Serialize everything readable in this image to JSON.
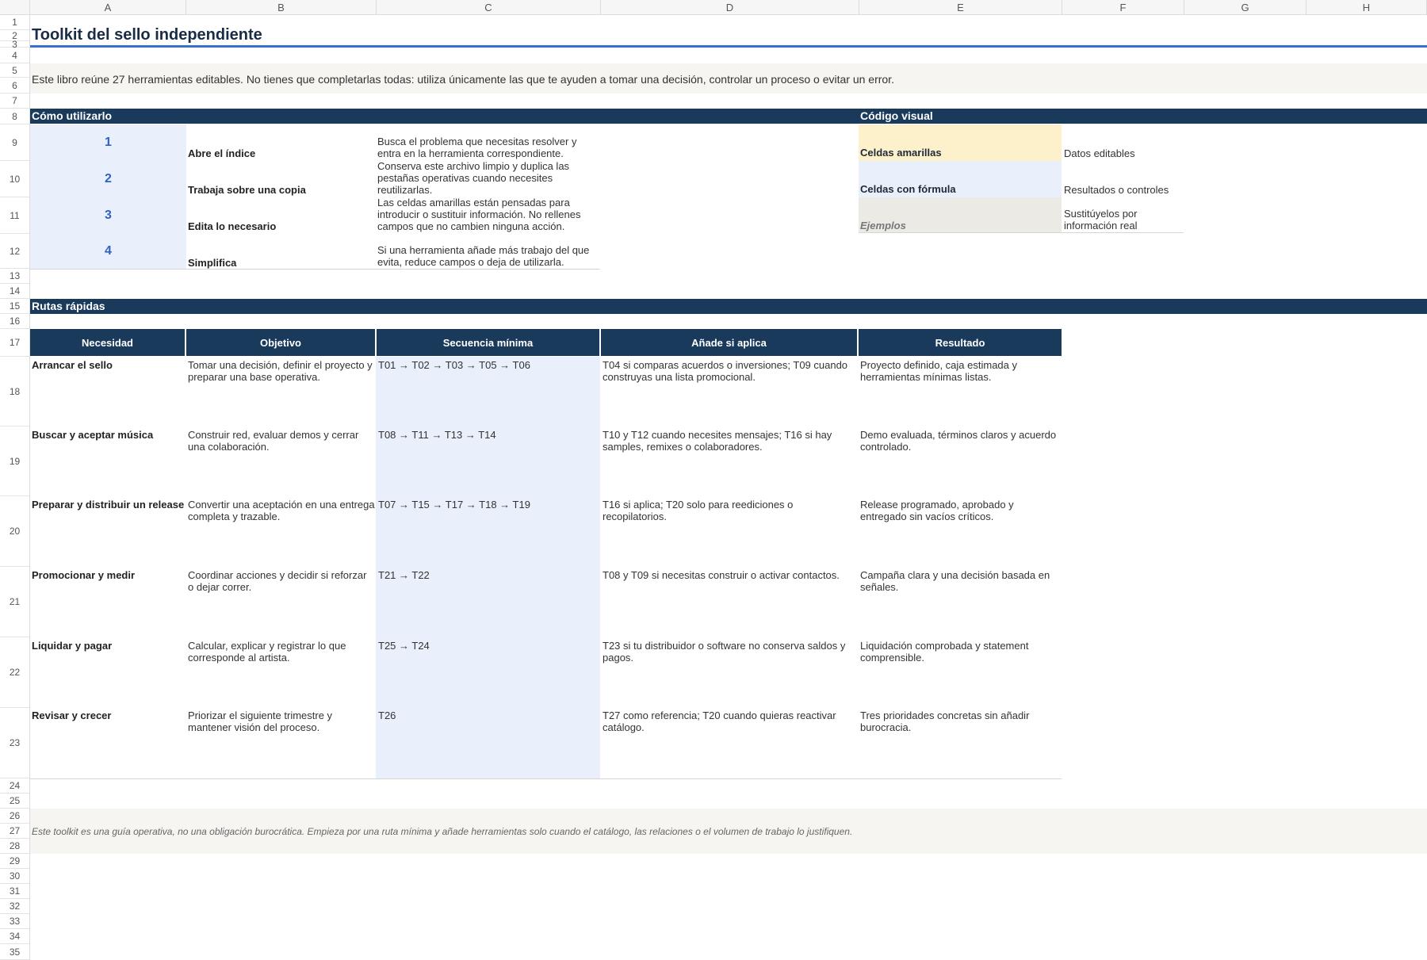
{
  "columns": [
    "A",
    "B",
    "C",
    "D",
    "E",
    "F",
    "G",
    "H"
  ],
  "rows": [
    "1",
    "2",
    "3",
    "4",
    "5",
    "6",
    "7",
    "8",
    "9",
    "10",
    "11",
    "12",
    "13",
    "14",
    "15",
    "16",
    "17",
    "18",
    "19",
    "20",
    "21",
    "22",
    "23",
    "24",
    "25",
    "26",
    "27",
    "28",
    "29",
    "30",
    "31",
    "32",
    "33",
    "34",
    "35"
  ],
  "title": "Toolkit del sello independiente",
  "intro": "Este libro reúne 27 herramientas editables. No tienes que completarlas todas: utiliza únicamente las que te ayuden a tomar una decisión, controlar un proceso o evitar un error.",
  "como": {
    "header": "Cómo utilizarlo",
    "steps": [
      {
        "num": "1",
        "name": "Abre el índice",
        "desc": "Busca el problema que necesitas resolver y entra en la herramienta correspondiente."
      },
      {
        "num": "2",
        "name": "Trabaja sobre una copia",
        "desc": "Conserva este archivo limpio y duplica las pestañas operativas cuando necesites reutilizarlas."
      },
      {
        "num": "3",
        "name": "Edita lo necesario",
        "desc": "Las celdas amarillas están pensadas para introducir o sustituir información. No rellenes campos que no cambien ninguna acción."
      },
      {
        "num": "4",
        "name": "Simplifica",
        "desc": "Si una herramienta añade más trabajo del que evita, reduce campos o deja de utilizarla."
      }
    ]
  },
  "codigo": {
    "header": "Código visual",
    "items": [
      {
        "label": "Celdas amarillas",
        "desc": "Datos editables",
        "color": "#fdf1cc"
      },
      {
        "label": "Celdas con fórmula",
        "desc": "Resultados o controles",
        "color": "#e9f0fb"
      },
      {
        "label": "Ejemplos",
        "desc": "Sustitúyelos por información real",
        "color": "#ebeae5"
      }
    ]
  },
  "rutas": {
    "header": "Rutas rápidas",
    "columns": [
      "Necesidad",
      "Objetivo",
      "Secuencia mínima",
      "Añade si aplica",
      "Resultado"
    ],
    "rows": [
      {
        "necesidad": "Arrancar el sello",
        "objetivo": "Tomar una decisión, definir el proyecto y preparar una base operativa.",
        "secuencia": "T01 → T02 → T03 → T05 → T06",
        "anade": "T04 si comparas acuerdos o inversiones; T09 cuando construyas una lista promocional.",
        "resultado": "Proyecto definido, caja estimada y herramientas mínimas listas."
      },
      {
        "necesidad": "Buscar y aceptar música",
        "objetivo": "Construir red, evaluar demos y cerrar una colaboración.",
        "secuencia": "T08 → T11 → T13 → T14",
        "anade": "T10 y T12 cuando necesites mensajes; T16 si hay samples, remixes o colaboradores.",
        "resultado": "Demo evaluada, términos claros y acuerdo controlado."
      },
      {
        "necesidad": "Preparar y distribuir un release",
        "objetivo": "Convertir una aceptación en una entrega completa y trazable.",
        "secuencia": "T07 → T15 → T17 → T18 → T19",
        "anade": "T16 si aplica; T20 solo para reediciones o recopilatorios.",
        "resultado": "Release programado, aprobado y entregado sin vacíos críticos."
      },
      {
        "necesidad": "Promocionar y medir",
        "objetivo": "Coordinar acciones y decidir si reforzar o dejar correr.",
        "secuencia": "T21 → T22",
        "anade": "T08 y T09 si necesitas construir o activar contactos.",
        "resultado": "Campaña clara y una decisión basada en señales."
      },
      {
        "necesidad": "Liquidar y pagar",
        "objetivo": "Calcular, explicar y registrar lo que corresponde al artista.",
        "secuencia": "T25 → T24",
        "anade": "T23 si tu distribuidor o software no conserva saldos y pagos.",
        "resultado": "Liquidación comprobada y statement comprensible."
      },
      {
        "necesidad": "Revisar y crecer",
        "objetivo": "Priorizar el siguiente trimestre y mantener visión del proceso.",
        "secuencia": "T26",
        "anade": "T27 como referencia; T20 cuando quieras reactivar catálogo.",
        "resultado": "Tres prioridades concretas sin añadir burocracia."
      }
    ]
  },
  "footer": "Este toolkit es una guía operativa, no una obligación burocrática. Empieza por una ruta mínima y añade herramientas solo cuando el catálogo, las relaciones o el volumen de trabajo lo justifiquen.",
  "colors": {
    "navy": "#1a3a5c",
    "accent_blue": "#3a6fd0",
    "formula_blue": "#e9f0fb",
    "editable_yellow": "#fdf1cc",
    "example_gray": "#ebeae5",
    "note_bg": "#f6f5f1"
  }
}
